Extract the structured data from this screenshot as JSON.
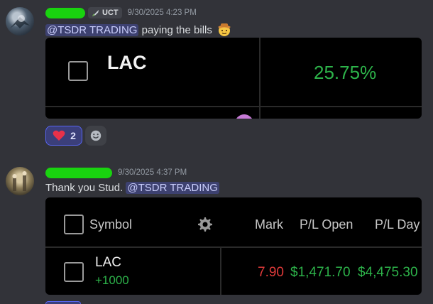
{
  "message1": {
    "badge": "UCT",
    "timestamp": "9/30/2025 4:23 PM",
    "mention": "@TSDR TRADING",
    "text": "paying the bills",
    "card": {
      "symbol": "LAC",
      "percent": "25.75%"
    },
    "reactions": [
      {
        "emoji": "heart",
        "count": "2"
      }
    ]
  },
  "message2": {
    "timestamp": "9/30/2025 4:37 PM",
    "text": "Thank you Stud.",
    "mention": "@TSDR TRADING",
    "table": {
      "headers": {
        "symbol": "Symbol",
        "mark": "Mark",
        "pl_open": "P/L Open",
        "pl_day": "P/L Day"
      },
      "row": {
        "symbol": "LAC",
        "qty": "+1000",
        "mark": "7.90",
        "pl_open": "$1,471.70",
        "pl_day": "$4,475.30"
      }
    }
  },
  "colors": {
    "background": "#323339",
    "mention": "#c9cdfb",
    "positive": "#2db34a",
    "negative": "#e03a3a",
    "redaction": "#19d30f"
  }
}
